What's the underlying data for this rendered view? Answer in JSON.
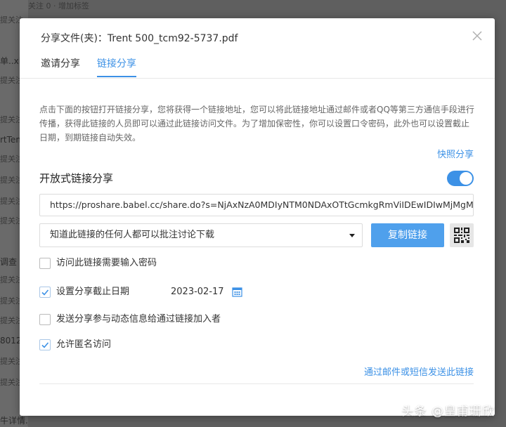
{
  "background": {
    "top_text": "关注 0  · 增加标签",
    "rows": [
      {
        "text": "提关注",
        "small": true
      },
      {
        "text": "单..xl",
        "small": false
      },
      {
        "text": "提关注",
        "small": true
      },
      {
        "text": "提关注",
        "small": true
      },
      {
        "text": "rtTem",
        "small": false
      },
      {
        "text": "提关注",
        "small": true
      },
      {
        "text": "提关注",
        "small": true
      },
      {
        "text": "提关注",
        "small": true
      },
      {
        "text": "提关注",
        "small": true
      },
      {
        "text": "调查",
        "small": false
      },
      {
        "text": "提关注",
        "small": true
      },
      {
        "text": "提关注",
        "small": true
      },
      {
        "text": "提关注",
        "small": true
      },
      {
        "text": "8012",
        "small": false
      },
      {
        "text": "提关注",
        "small": true
      },
      {
        "text": "提关注",
        "small": true
      },
      {
        "text": "牛详情.jpg",
        "small": false
      }
    ]
  },
  "dialog": {
    "title": "分享文件(夹)：Trent 500_tcm92-5737.pdf",
    "tabs": [
      {
        "label": "邀请分享",
        "active": false
      },
      {
        "label": "链接分享",
        "active": true
      }
    ],
    "description": "点击下面的按钮打开链接分享，您将获得一个链接地址，您可以将此链接地址通过邮件或者QQ等第三方通信手段进行传播，获得此链接的人员即可以通过此链接访问文件。为了增加保密性，你可以设置口令密码，此外也可以设置截止日期，到期链接自动失效。",
    "quick_share": "快照分享",
    "open_link_title": "开放式链接分享",
    "toggle_on": true,
    "share_url": "https://proshare.babel.cc/share.do?s=NjAxNzA0MDIyNTM0NDAxOTtGcmkgRmViIDEwIDIwMjMgMT",
    "permission_selected": "知道此链接的任何人都可以批注讨论下载",
    "copy_button": "复制链接",
    "options": {
      "password": {
        "label": "访问此链接需要输入密码",
        "checked": false
      },
      "expire": {
        "label": "设置分享截止日期",
        "checked": true,
        "date": "2023-02-17"
      },
      "notify": {
        "label": "发送分享参与动态信息给通过链接加入者",
        "checked": false
      },
      "anonymous": {
        "label": "允许匿名访问",
        "checked": true
      }
    },
    "send_link": "通过邮件或短信发送此链接"
  },
  "watermark": "头条 @皇甫珊欣",
  "colors": {
    "accent": "#3c91e6",
    "button": "#4fa0ec",
    "overlay": "#5f5f5f"
  }
}
